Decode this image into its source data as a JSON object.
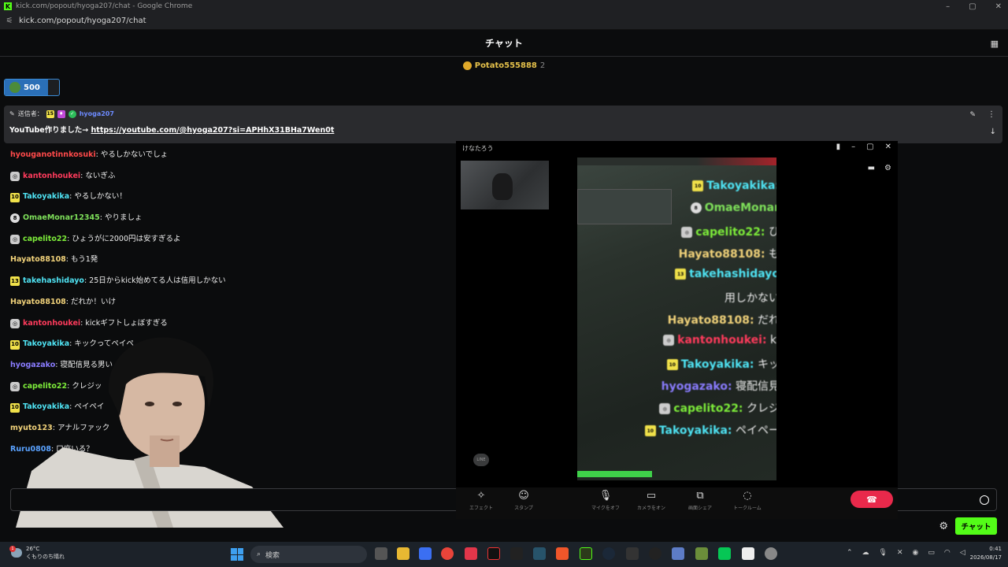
{
  "window": {
    "title": "kick.com/popout/hyoga207/chat - Google Chrome",
    "url": "kick.com/popout/hyoga207/chat",
    "controls": [
      "–",
      "▢",
      "✕"
    ]
  },
  "header": {
    "title": "チャット"
  },
  "gift_leader": {
    "name": "Potato555888",
    "count": "2"
  },
  "points": {
    "value": "500",
    "fill_fraction": 0.8
  },
  "pinned": {
    "sender_label": "送信者：",
    "badge_sub": "15",
    "user": "hyoga207",
    "message_prefix": "YouTube作りました→ ",
    "link": "https://youtube.com/@hyoga207?si=APHhX31BHa7Wen0t"
  },
  "messages": [
    {
      "badge": "",
      "user": "hyouganotinnkosuki",
      "color": "#ff4a4a",
      "text": ": やるしかないでしょ"
    },
    {
      "badge": "icon",
      "user": "kantonhoukei",
      "color": "#ff3b5c",
      "text": ": ないぎふ"
    },
    {
      "badge": "10",
      "user": "Takoyakika",
      "color": "#4fe3f3",
      "text": ": やるしかない！"
    },
    {
      "badge": "8",
      "user": "OmaeMonar12345",
      "color": "#7ee05a",
      "text": ": やりましょ"
    },
    {
      "badge": "icon",
      "user": "capelito22",
      "color": "#7dec3a",
      "text": ": ひょうがに2000円は安すぎるよ"
    },
    {
      "badge": "",
      "user": "Hayato88108",
      "color": "#f1d27a",
      "text": ": もう1発"
    },
    {
      "badge": "13",
      "user": "takehashidayo",
      "color": "#4fe3f3",
      "text": ": 25日からkick始めてる人は信用しかない"
    },
    {
      "badge": "",
      "user": "Hayato88108",
      "color": "#f1d27a",
      "text": ": だれか！いけ"
    },
    {
      "badge": "icon",
      "user": "kantonhoukei",
      "color": "#ff3b5c",
      "text": ": kickギフトしょぼすぎる"
    },
    {
      "badge": "10",
      "user": "Takoyakika",
      "color": "#4fe3f3",
      "text": ": キックってペイペ"
    },
    {
      "badge": "",
      "user": "hyogazako",
      "color": "#8a7cff",
      "text": ": 寝配信見る男い"
    },
    {
      "badge": "icon",
      "user": "capelito22",
      "color": "#7dec3a",
      "text": ": クレジッ"
    },
    {
      "badge": "10",
      "user": "Takoyakika",
      "color": "#4fe3f3",
      "text": ": ペイペイ"
    },
    {
      "badge": "",
      "user": "myuto123",
      "color": "#f1d27a",
      "text": ": アナルファック"
    },
    {
      "badge": "",
      "user": "Ruru0808",
      "color": "#5aa2ff",
      "text": ": 口座いる？"
    }
  ],
  "footer": {
    "chat_button": "チャット"
  },
  "call": {
    "title": "けなたろう",
    "video_lines": [
      {
        "badge": "10",
        "user": "Takoyakika:",
        "color": "#4fe3f3",
        "text": ""
      },
      {
        "badge": "8",
        "user": "OmaeMonar",
        "color": "#7ee05a",
        "text": ""
      },
      {
        "badge": "icon",
        "user": "capelito22:",
        "color": "#7dec3a",
        "text": "ひ"
      },
      {
        "badge": "",
        "user": "Hayato88108:",
        "color": "#f1d27a",
        "text": "も"
      },
      {
        "badge": "13",
        "user": "takehashidayo",
        "color": "#4fe3f3",
        "text": ""
      },
      {
        "badge": "",
        "user": "",
        "color": "#eee",
        "text": "用しかない"
      },
      {
        "badge": "",
        "user": "Hayato88108:",
        "color": "#f1d27a",
        "text": "だれ"
      },
      {
        "badge": "icon",
        "user": "kantonhoukei:",
        "color": "#ff3b5c",
        "text": "ki"
      },
      {
        "badge": "10",
        "user": "Takoyakika:",
        "color": "#4fe3f3",
        "text": "キッ"
      },
      {
        "badge": "",
        "user": "hyogazako:",
        "color": "#8a7cff",
        "text": "寝配信見"
      },
      {
        "badge": "icon",
        "user": "capelito22:",
        "color": "#7dec3a",
        "text": "クレジ"
      },
      {
        "badge": "10",
        "user": "Takoyakika:",
        "color": "#4fe3f3",
        "text": "ペイペー"
      }
    ],
    "toolbar": [
      {
        "icon": "✧",
        "label": "エフェクト"
      },
      {
        "icon": "☺",
        "label": "スタンプ"
      },
      {
        "icon": "🎙",
        "label": "マイクをオフ"
      },
      {
        "icon": "▭",
        "label": "カメラをオン"
      },
      {
        "icon": "⧉",
        "label": "画面シェア"
      },
      {
        "icon": "◌",
        "label": "トークルーム"
      }
    ],
    "line_watermark": "LINE"
  },
  "taskbar": {
    "weather_temp": "26°C",
    "weather_desc": "くもりのち晴れ",
    "weather_alert": "1",
    "search_placeholder": "検索",
    "time": "0:41",
    "date": "2026/08/17"
  }
}
